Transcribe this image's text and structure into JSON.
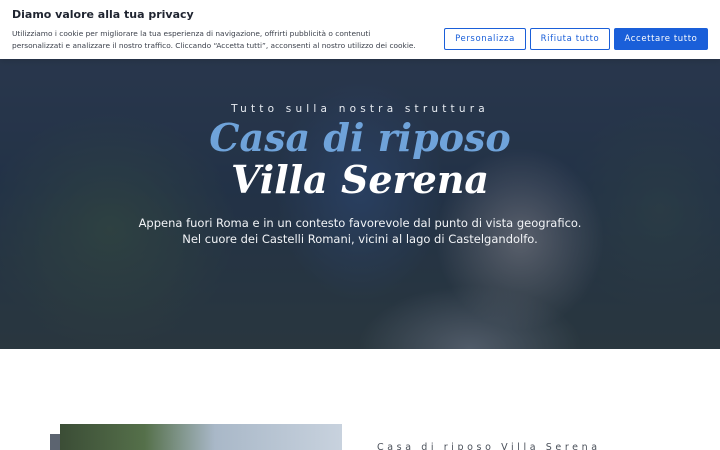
{
  "cookie_banner": {
    "title": "Diamo valore alla tua privacy",
    "text": "Utilizziamo i cookie per migliorare la tua esperienza di navigazione, offrirti pubblicità o contenuti personalizzati e analizzare il nostro traffico. Cliccando “Accetta tutti”, acconsenti al nostro utilizzo dei cookie.",
    "personalize_label": "Personalizza",
    "reject_label": "Rifiuta tutto",
    "accept_label": "Accettare tutto",
    "accent_color": "#1a5fd9"
  },
  "hero": {
    "kicker": "Tutto sulla nostra struttura",
    "title_line1": "Casa di riposo",
    "title_line2": "Villa Serena",
    "subtitle_line1": "Appena fuori Roma e in un contesto favorevole dal punto di vista geografico.",
    "subtitle_line2": "Nel cuore dei Castelli Romani, vicini al lago di Castelgandolfo.",
    "title_accent_color": "#6fa3da"
  },
  "section": {
    "kicker": "Casa di riposo Villa Serena"
  }
}
